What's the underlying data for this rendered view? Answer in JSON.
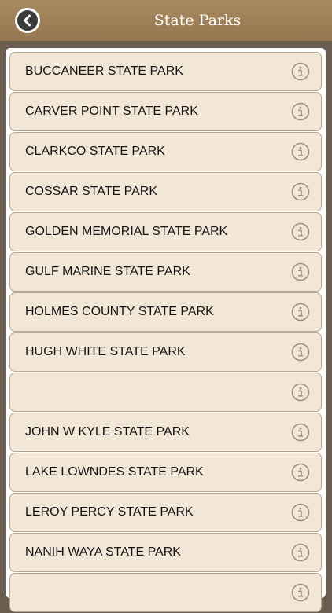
{
  "header": {
    "title": "State Parks",
    "back_icon": "back-arrow-icon"
  },
  "colors": {
    "header": "#9c7e57",
    "row_background": "#f2e7d7",
    "row_border": "#b8a78e",
    "info_icon": "#9c8f7e",
    "outer_background": "#6b5d4f"
  },
  "parks": [
    {
      "name": "BUCCANEER STATE PARK"
    },
    {
      "name": "CARVER POINT STATE PARK"
    },
    {
      "name": "CLARKCO STATE PARK"
    },
    {
      "name": "COSSAR STATE PARK"
    },
    {
      "name": "GOLDEN MEMORIAL STATE PARK"
    },
    {
      "name": "GULF MARINE STATE PARK"
    },
    {
      "name": "HOLMES COUNTY STATE PARK"
    },
    {
      "name": "HUGH WHITE STATE PARK"
    },
    {
      "name": ""
    },
    {
      "name": "JOHN W KYLE STATE PARK"
    },
    {
      "name": "LAKE LOWNDES STATE PARK"
    },
    {
      "name": "LEROY PERCY STATE PARK"
    },
    {
      "name": "NANIH WAYA STATE PARK"
    },
    {
      "name": ""
    }
  ]
}
